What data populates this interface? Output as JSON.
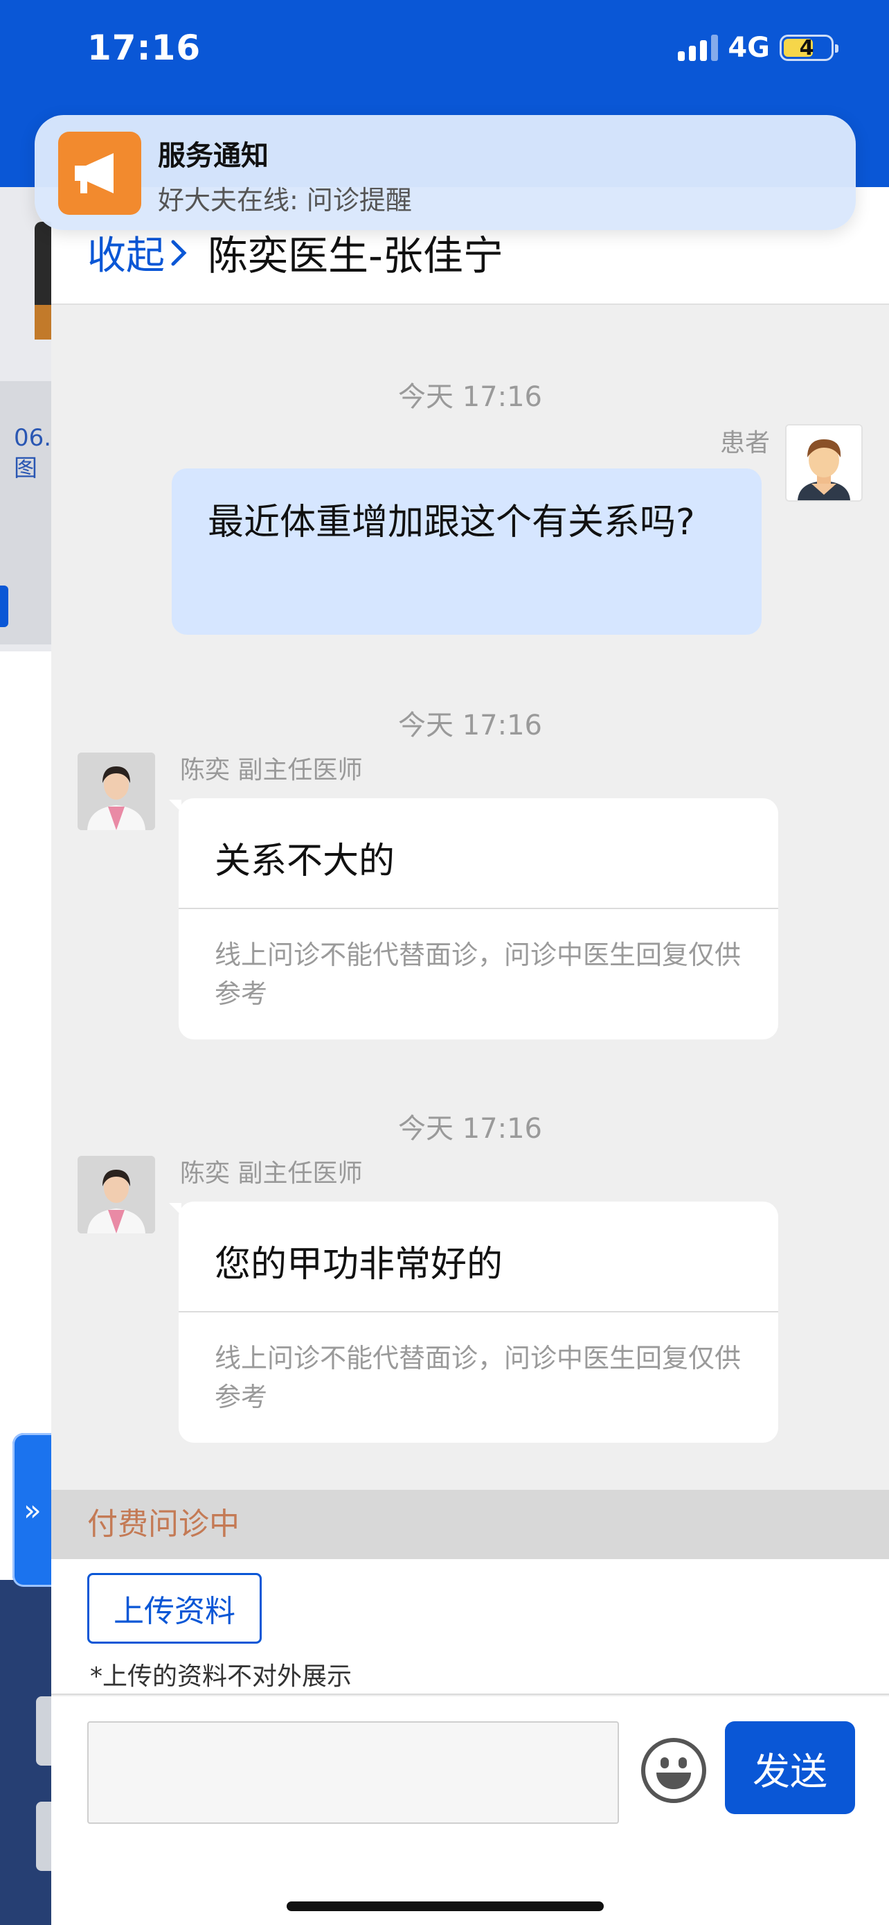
{
  "status_bar": {
    "time": "17:16",
    "network": "4G",
    "battery": "4"
  },
  "notification": {
    "title": "服务通知",
    "body": "好大夫在线: 问诊提醒",
    "icon": "megaphone-icon"
  },
  "drawer": {
    "collapse_label": "收起",
    "title": "陈奕医生-张佳宁"
  },
  "messages": [
    {
      "timestamp": "今天 17:16",
      "sender": "患者",
      "text": "最近体重增加跟这个有关系吗?"
    },
    {
      "timestamp": "今天 17:16",
      "sender": "陈奕 副主任医师",
      "text": "关系不大的",
      "note": "线上问诊不能代替面诊，问诊中医生回复仅供参考"
    },
    {
      "timestamp": "今天 17:16",
      "sender": "陈奕 副主任医师",
      "text": "您的甲功非常好的",
      "note": "线上问诊不能代替面诊，问诊中医生回复仅供参考"
    }
  ],
  "status_label": "付费问诊中",
  "upload": {
    "button_label": "上传资料",
    "note": "*上传的资料不对外展示"
  },
  "composer": {
    "input_value": "",
    "send_label": "发送"
  },
  "background_page": {
    "date_text": "06.",
    "date_subtext": "图"
  },
  "colors": {
    "brand": "#0a57d6",
    "patient_bubble": "#d6e6ff",
    "paid_status": "#c47a55"
  }
}
